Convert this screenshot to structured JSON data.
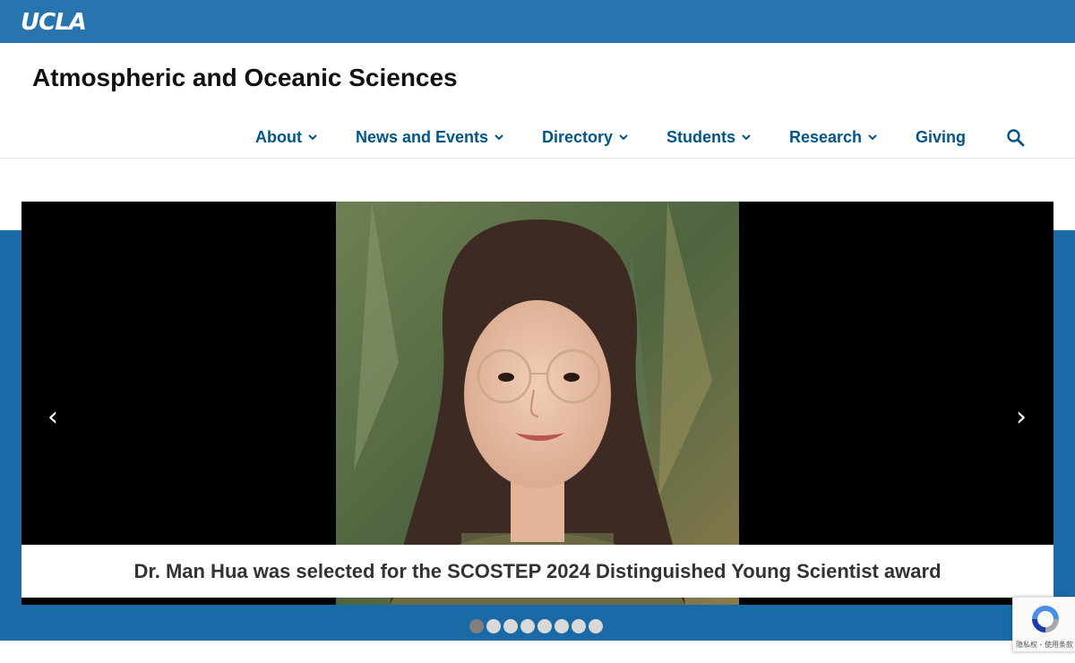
{
  "header": {
    "logo_text": "UCLA",
    "site_title": "Atmospheric and Oceanic Sciences"
  },
  "nav": {
    "items": [
      {
        "label": "About",
        "has_dropdown": true
      },
      {
        "label": "News and Events",
        "has_dropdown": true
      },
      {
        "label": "Directory",
        "has_dropdown": true
      },
      {
        "label": "Students",
        "has_dropdown": true
      },
      {
        "label": "Research",
        "has_dropdown": true
      },
      {
        "label": "Giving",
        "has_dropdown": false
      }
    ],
    "search_icon": "search-icon"
  },
  "slider": {
    "prev_label": "‹",
    "next_label": "›",
    "caption": "Dr. Man Hua was selected for the SCOSTEP 2024 Distinguished Young Scientist award",
    "total_slides": 8,
    "active_slide": 1
  },
  "recaptcha": {
    "label": "隐私权 - 使用条款"
  },
  "colors": {
    "ucla_blue": "#2774ae",
    "band_blue": "#1a6aa8",
    "nav_text": "#005587"
  }
}
